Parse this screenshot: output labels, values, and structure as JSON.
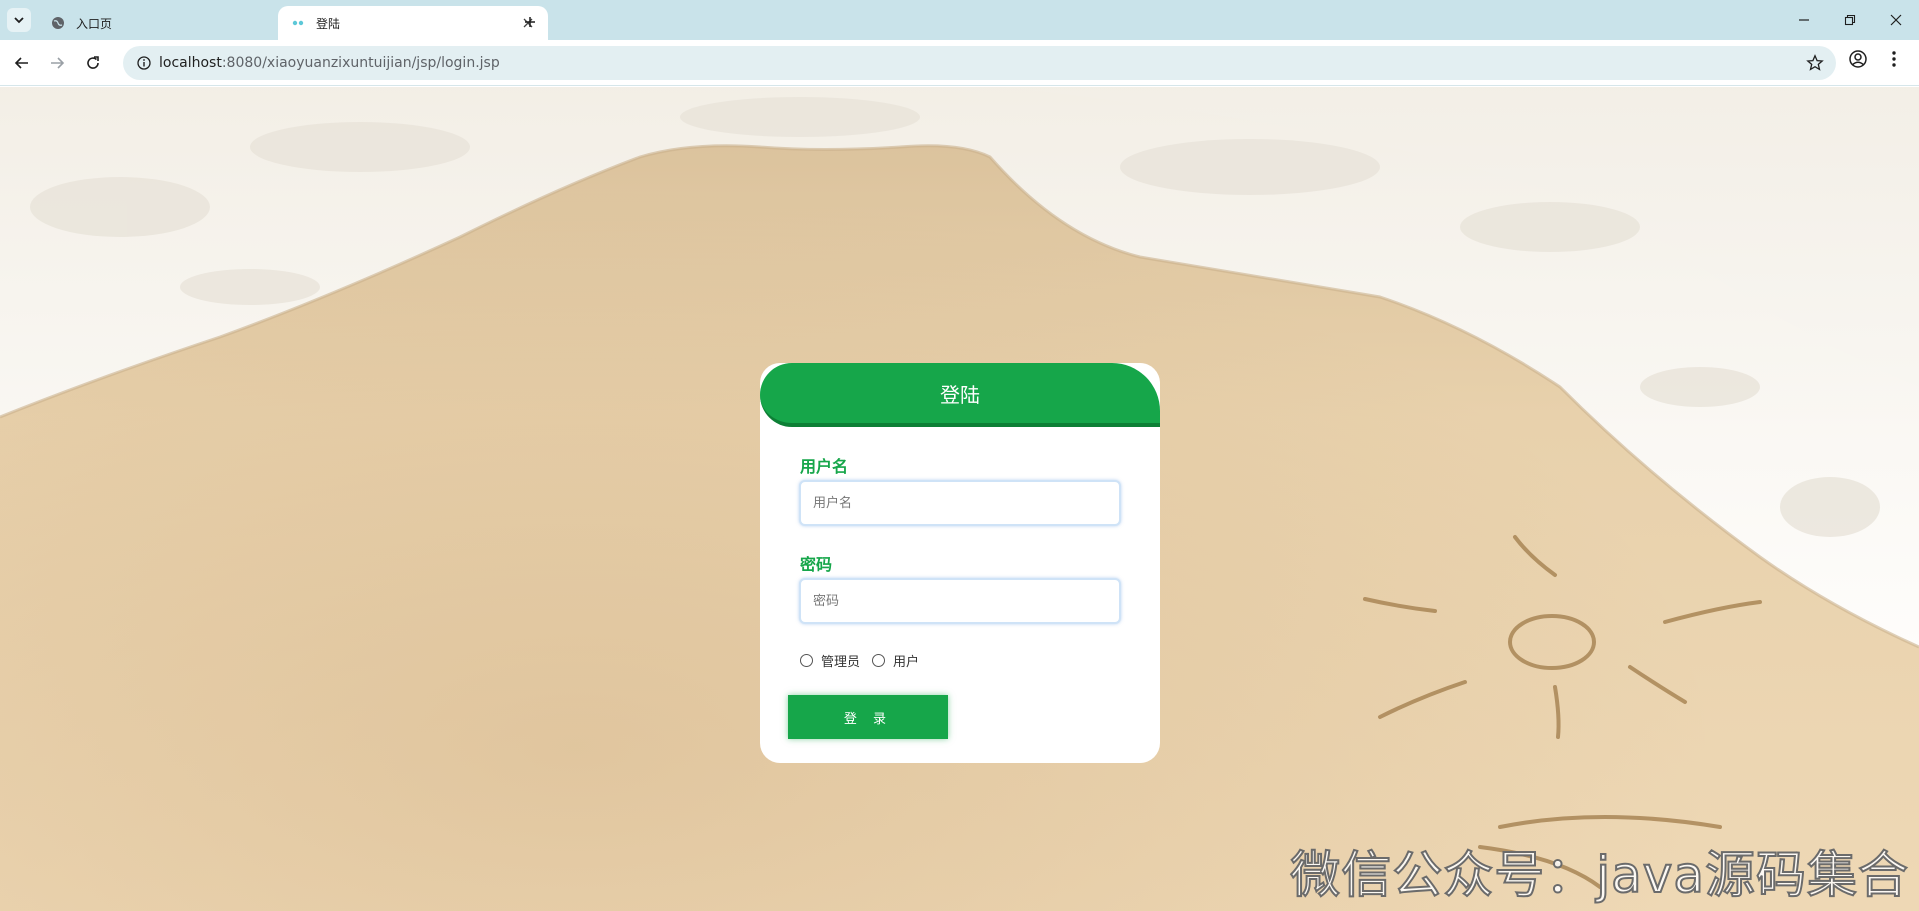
{
  "browser": {
    "tabs": [
      {
        "title": "入口页",
        "active": false,
        "icon": "globe-icon"
      },
      {
        "title": "登陆",
        "active": true,
        "icon": "dots-icon"
      }
    ],
    "url_host": "localhost",
    "url_rest": ":8080/xiaoyuanzixuntuijian/jsp/login.jsp"
  },
  "login": {
    "title": "登陆",
    "username_label": "用户名",
    "username_placeholder": "用户名",
    "password_label": "密码",
    "password_placeholder": "密码",
    "roles": [
      "管理员",
      "用户"
    ],
    "submit": "登 录"
  },
  "watermark": "微信公众号：java源码集合",
  "colors": {
    "accent": "#16a64a",
    "accent_dark": "#0d7f35",
    "tabbar": "#c9e3ea"
  }
}
